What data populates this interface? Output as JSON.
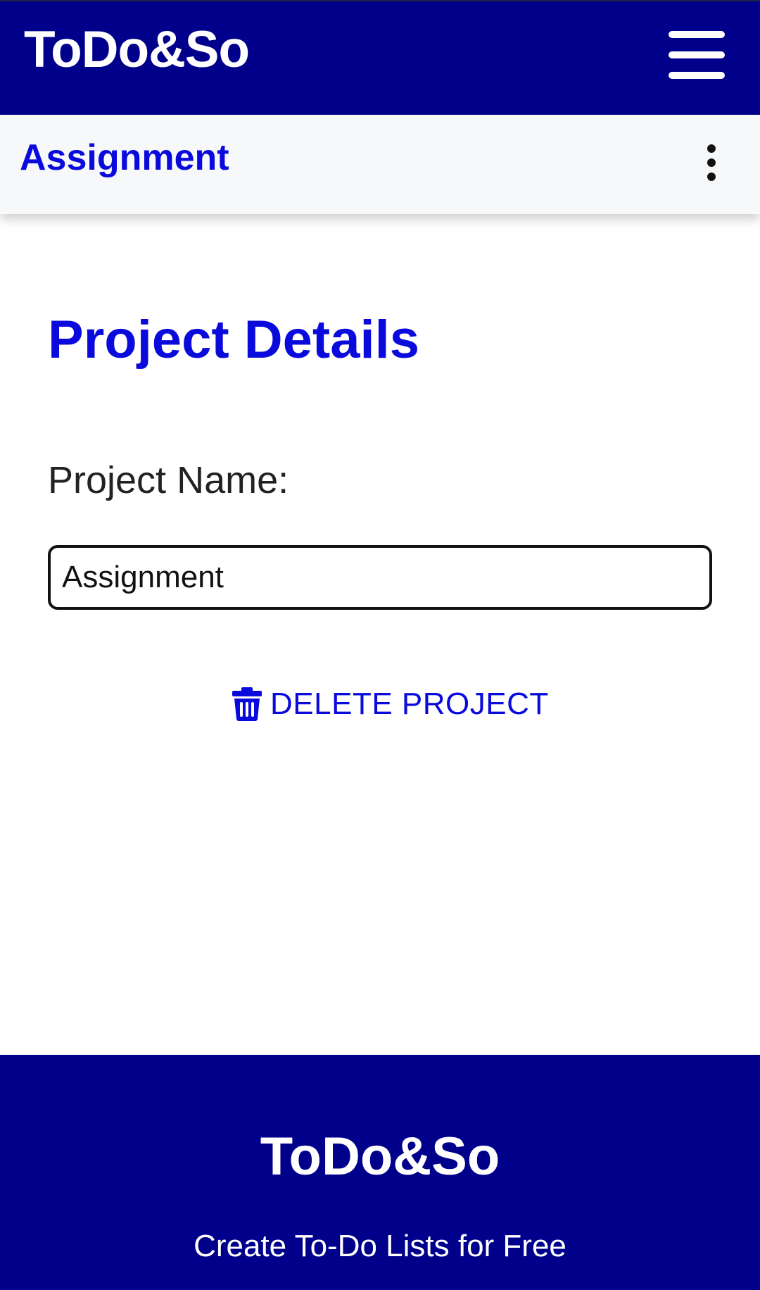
{
  "header": {
    "brand": "ToDo&So",
    "menu_icon": "hamburger-menu-icon"
  },
  "subheader": {
    "title": "Assignment",
    "more_icon": "more-vertical-icon"
  },
  "main": {
    "title": "Project Details",
    "project_name_label": "Project Name:",
    "project_name_value": "Assignment",
    "delete_label": "DELETE PROJECT",
    "delete_icon": "trash-icon"
  },
  "footer": {
    "brand": "ToDo&So",
    "tagline": "Create To-Do Lists for Free"
  },
  "colors": {
    "header_bg": "#00008B",
    "accent": "#0A0ADC",
    "subheader_bg": "#F7F8F9"
  }
}
